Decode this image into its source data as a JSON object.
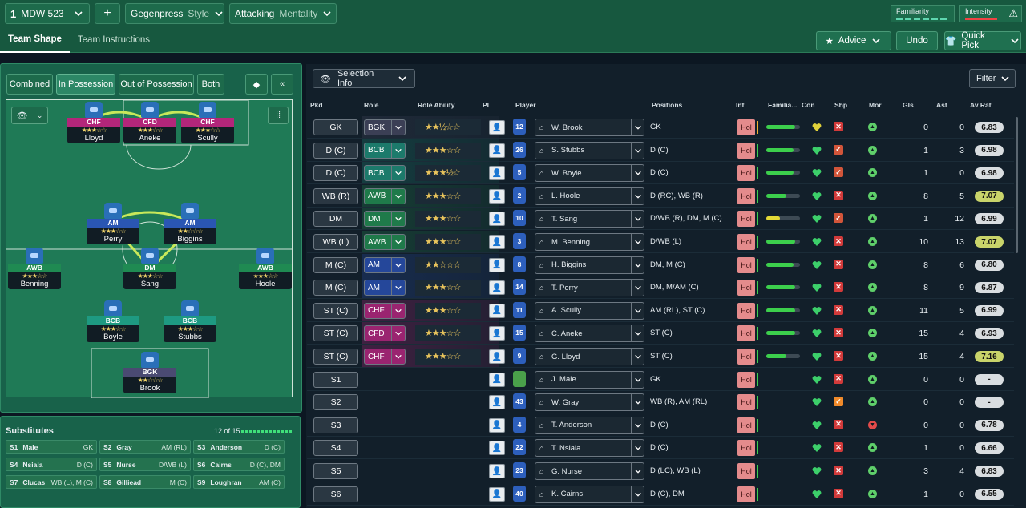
{
  "top": {
    "formation_num": "1",
    "formation_name": "MDW 523",
    "style_value": "Gegenpress",
    "style_label": "Style",
    "mentality_value": "Attacking",
    "mentality_label": "Mentality",
    "familiarity_label": "Familiarity",
    "intensity_label": "Intensity"
  },
  "tabs": {
    "team_shape": "Team Shape",
    "team_instructions": "Team Instructions"
  },
  "actions": {
    "advice": "Advice",
    "undo": "Undo",
    "quick_pick": "Quick Pick"
  },
  "modes": {
    "combined": "Combined",
    "in_possession": "In Possession",
    "out_possession": "Out of Possession",
    "both": "Both"
  },
  "pitch_players": [
    {
      "role": "CHF",
      "stars": "★★★☆☆",
      "name": "Lloyd",
      "color": "#b3267a"
    },
    {
      "role": "CFD",
      "stars": "★★★☆☆",
      "name": "Aneke",
      "color": "#b3267a"
    },
    {
      "role": "CHF",
      "stars": "★★★☆☆",
      "name": "Scully",
      "color": "#b3267a"
    },
    {
      "role": "AM",
      "stars": "★★★☆☆",
      "name": "Perry",
      "color": "#2a56b3"
    },
    {
      "role": "AM",
      "stars": "★★☆☆☆",
      "name": "Biggins",
      "color": "#2a56b3"
    },
    {
      "role": "AWB",
      "stars": "★★★☆☆",
      "name": "Benning",
      "color": "#1f8a52"
    },
    {
      "role": "DM",
      "stars": "★★★☆☆",
      "name": "Sang",
      "color": "#1f8a52"
    },
    {
      "role": "AWB",
      "stars": "★★★☆☆",
      "name": "Hoole",
      "color": "#1f8a52"
    },
    {
      "role": "BCB",
      "stars": "★★★☆☆",
      "name": "Boyle",
      "color": "#1e9a82"
    },
    {
      "role": "BCB",
      "stars": "★★★☆☆",
      "name": "Stubbs",
      "color": "#1e9a82"
    },
    {
      "role": "BGK",
      "stars": "★★☆☆☆",
      "name": "Brook",
      "color": "#4a4a72"
    }
  ],
  "substitutes": {
    "title": "Substitutes",
    "count": "12 of 15",
    "items": [
      {
        "slot": "S1",
        "name": "Male",
        "pos": "GK"
      },
      {
        "slot": "S2",
        "name": "Gray",
        "pos": "AM (RL)"
      },
      {
        "slot": "S3",
        "name": "Anderson",
        "pos": "D (C)"
      },
      {
        "slot": "S4",
        "name": "Nsiala",
        "pos": "D (C)"
      },
      {
        "slot": "S5",
        "name": "Nurse",
        "pos": "D/WB (L)"
      },
      {
        "slot": "S6",
        "name": "Cairns",
        "pos": "D (C), DM"
      },
      {
        "slot": "S7",
        "name": "Clucas",
        "pos": "WB (L), M (C)"
      },
      {
        "slot": "S8",
        "name": "Gilliead",
        "pos": "M (C)"
      },
      {
        "slot": "S9",
        "name": "Loughran",
        "pos": "AM (C)"
      }
    ]
  },
  "table": {
    "selection_info": "Selection Info",
    "filter": "Filter",
    "headers": {
      "pkd": "Pkd",
      "role": "Role",
      "ability": "Role Ability",
      "pi": "PI",
      "player": "Player",
      "positions": "Positions",
      "inf": "Inf",
      "fam": "Familia...",
      "con": "Con",
      "shp": "Shp",
      "mor": "Mor",
      "gls": "Gls",
      "ast": "Ast",
      "avr": "Av Rat"
    },
    "rows": [
      {
        "pkd": "GK",
        "role": "BGK",
        "stars": "★★½☆☆",
        "num": "12",
        "name": "W. Brook",
        "pos": "GK",
        "inf": "Hol",
        "fam": 0.85,
        "shp": "x",
        "gls": "0",
        "ast": "0",
        "avr": "6.83",
        "hi": false,
        "rc": "#3b3f55"
      },
      {
        "pkd": "D (C)",
        "role": "BCB",
        "stars": "★★★☆☆",
        "num": "26",
        "name": "S. Stubbs",
        "pos": "D (C)",
        "inf": "Hol",
        "fam": 0.8,
        "shp": "v",
        "gls": "1",
        "ast": "3",
        "avr": "6.98",
        "hi": false,
        "rc": "#1c7a6b"
      },
      {
        "pkd": "D (C)",
        "role": "BCB",
        "stars": "★★★½☆",
        "num": "5",
        "name": "W. Boyle",
        "pos": "D (C)",
        "inf": "Hol",
        "fam": 0.8,
        "shp": "v",
        "gls": "1",
        "ast": "0",
        "avr": "6.98",
        "hi": false,
        "rc": "#1c7a6b"
      },
      {
        "pkd": "WB (R)",
        "role": "AWB",
        "stars": "★★★☆☆",
        "num": "2",
        "name": "L. Hoole",
        "pos": "D (RC), WB (R)",
        "inf": "Hol",
        "fam": 0.6,
        "shp": "x",
        "gls": "8",
        "ast": "5",
        "avr": "7.07",
        "hi": true,
        "rc": "#1f7a4a"
      },
      {
        "pkd": "DM",
        "role": "DM",
        "stars": "★★★☆☆",
        "num": "10",
        "name": "T. Sang",
        "pos": "D/WB (R), DM, M (C)",
        "inf": "Hol",
        "fam": 0.4,
        "famc": "#e3d936",
        "shp": "v",
        "gls": "1",
        "ast": "12",
        "avr": "6.99",
        "hi": false,
        "rc": "#1f7a4a"
      },
      {
        "pkd": "WB (L)",
        "role": "AWB",
        "stars": "★★★☆☆",
        "num": "3",
        "name": "M. Benning",
        "pos": "D/WB (L)",
        "inf": "Hol",
        "fam": 0.85,
        "shp": "x",
        "gls": "10",
        "ast": "13",
        "avr": "7.07",
        "hi": true,
        "rc": "#1f7a4a"
      },
      {
        "pkd": "M (C)",
        "role": "AM",
        "stars": "★★☆☆☆",
        "num": "8",
        "name": "H. Biggins",
        "pos": "DM, M (C)",
        "inf": "Hol",
        "fam": 0.8,
        "shp": "x",
        "gls": "8",
        "ast": "6",
        "avr": "6.80",
        "hi": false,
        "rc": "#25479a"
      },
      {
        "pkd": "M (C)",
        "role": "AM",
        "stars": "★★★☆☆",
        "num": "14",
        "name": "T. Perry",
        "pos": "DM, M/AM (C)",
        "inf": "Hol",
        "fam": 0.85,
        "shp": "x",
        "gls": "8",
        "ast": "9",
        "avr": "6.87",
        "hi": false,
        "rc": "#25479a"
      },
      {
        "pkd": "ST (C)",
        "role": "CHF",
        "stars": "★★★☆☆",
        "num": "11",
        "name": "A. Scully",
        "pos": "AM (RL), ST (C)",
        "inf": "Hol",
        "fam": 0.85,
        "shp": "x",
        "gls": "11",
        "ast": "5",
        "avr": "6.99",
        "hi": false,
        "rc": "#9a2470"
      },
      {
        "pkd": "ST (C)",
        "role": "CFD",
        "stars": "★★★☆☆",
        "num": "15",
        "name": "C. Aneke",
        "pos": "ST (C)",
        "inf": "Hol",
        "fam": 0.85,
        "shp": "x",
        "gls": "15",
        "ast": "4",
        "avr": "6.93",
        "hi": false,
        "rc": "#9a2470"
      },
      {
        "pkd": "ST (C)",
        "role": "CHF",
        "stars": "★★★☆☆",
        "num": "9",
        "name": "G. Lloyd",
        "pos": "ST (C)",
        "inf": "Hol",
        "fam": 0.6,
        "shp": "x",
        "gls": "15",
        "ast": "4",
        "avr": "7.16",
        "hi": true,
        "rc": "#9a2470"
      },
      {
        "pkd": "S1",
        "role": "",
        "stars": "",
        "num": "",
        "name": "J. Male",
        "pos": "GK",
        "inf": "Hol",
        "fam": 0,
        "shp": "x",
        "gls": "0",
        "ast": "0",
        "avr": "-",
        "hi": false,
        "rc": ""
      },
      {
        "pkd": "S2",
        "role": "",
        "stars": "",
        "num": "43",
        "name": "W. Gray",
        "pos": "WB (R), AM (RL)",
        "inf": "Hol",
        "fam": 0,
        "shp": "o",
        "gls": "0",
        "ast": "0",
        "avr": "-",
        "hi": false,
        "rc": ""
      },
      {
        "pkd": "S3",
        "role": "",
        "stars": "",
        "num": "4",
        "name": "T. Anderson",
        "pos": "D (C)",
        "inf": "Hol",
        "fam": 0,
        "shp": "x",
        "gls": "0",
        "ast": "0",
        "avr": "6.78",
        "hi": false,
        "rc": "",
        "morbad": true
      },
      {
        "pkd": "S4",
        "role": "",
        "stars": "",
        "num": "22",
        "name": "T. Nsiala",
        "pos": "D (C)",
        "inf": "Hol",
        "fam": 0,
        "shp": "x",
        "gls": "1",
        "ast": "0",
        "avr": "6.66",
        "hi": false,
        "rc": ""
      },
      {
        "pkd": "S5",
        "role": "",
        "stars": "",
        "num": "23",
        "name": "G. Nurse",
        "pos": "D (LC), WB (L)",
        "inf": "Hol",
        "fam": 0,
        "shp": "x",
        "gls": "3",
        "ast": "4",
        "avr": "6.83",
        "hi": false,
        "rc": ""
      },
      {
        "pkd": "S6",
        "role": "",
        "stars": "",
        "num": "40",
        "name": "K. Cairns",
        "pos": "D (C), DM",
        "inf": "Hol",
        "fam": 0,
        "shp": "x",
        "gls": "1",
        "ast": "0",
        "avr": "6.55",
        "hi": false,
        "rc": ""
      }
    ]
  }
}
